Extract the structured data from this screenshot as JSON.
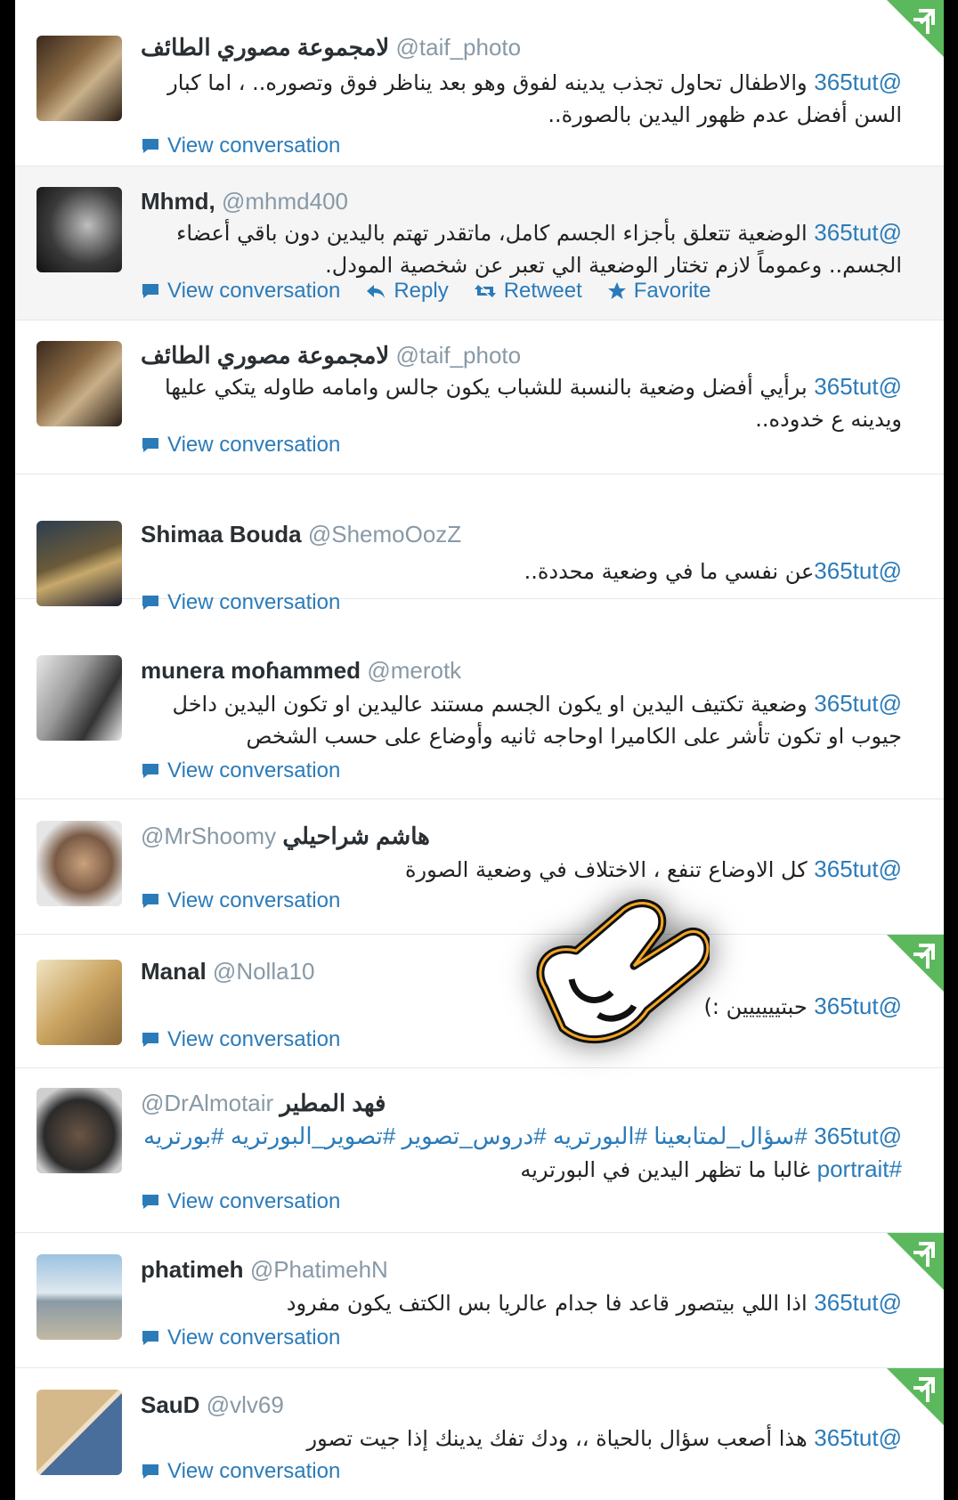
{
  "tweets": [
    {
      "name": "لامجموعة مصوري الطائف",
      "handle": "@taif_photo",
      "mention": "@365tut",
      "text": "والاطفال تحاول تجذب يدينه لفوق وهو بعد يناظر فوق وتصوره.. ، اما كبار السن أفضل عدم ظهور اليدين بالصورة..",
      "view": "View conversation"
    },
    {
      "name": "Mhmd,",
      "handle": "@mhmd400",
      "mention": "@365tut",
      "text": "الوضعية تتعلق بأجزاء الجسم كامل، ماتقدر تهتم باليدين دون باقي أعضاء الجسم.. وعموماً لازم تختار الوضعية الي تعبر عن شخصية المودل.",
      "view": "View conversation",
      "reply": "Reply",
      "retweet": "Retweet",
      "favorite": "Favorite"
    },
    {
      "name": "لامجموعة مصوري الطائف",
      "handle": "@taif_photo",
      "mention": "@365tut",
      "text": "برأيي أفضل وضعية بالنسبة للشباب يكون جالس وامامه طاوله يتكي عليها ويدينه ع خدوده..",
      "view": "View conversation"
    },
    {
      "name": "Shimaa Bouda",
      "handle": "@ShemoOozZ",
      "mention": "@365tut",
      "text": "عن نفسي ما في وضعية محددة..",
      "view": "View conversation"
    },
    {
      "name": "munera moɦammed",
      "handle": "@merotk",
      "mention": "@365tut",
      "text": "وضعية تكتيف اليدين او يكون الجسم مستند عاليدين او تكون اليدين داخل جيوب او تكون تأشر على الكاميرا اوحاجه ثانيه وأوضاع على حسب الشخص",
      "view": "View conversation"
    },
    {
      "name": "هاشم شراحيلي",
      "handle": "@MrShoomy",
      "mention": "@365tut",
      "text": "كل الاوضاع تنفع ، الاختلاف في وضعية الصورة",
      "view": "View conversation"
    },
    {
      "name": "Manal",
      "handle": "@Nolla10",
      "mention": "@365tut",
      "text": "حبتيييييين :)",
      "view": "View conversation"
    },
    {
      "name": "فهد المطير",
      "handle": "@DrAlmotair",
      "mention": "@365tut",
      "tags": "#سؤال_لمتابعينا #البورتريه #دروس_تصوير #تصوير_البورتريه #بورتريه",
      "tag2": "#portrait",
      "text": "غالبا ما تظهر اليدين في البورتريه",
      "view": "View conversation"
    },
    {
      "name": "phatimeh",
      "handle": "@PhatimehN",
      "mention": "@365tut",
      "text": "اذا اللي بيتصور قاعد فا جدام عالريا بس الكتف يكون مفرود",
      "view": "View conversation"
    },
    {
      "name": "SauD",
      "handle": "@vlv69",
      "mention": "@365tut",
      "text": "هذا أصعب سؤال بالحياة ،، ودك تفك يدينك إذا جيت تصور",
      "view": "View conversation"
    }
  ],
  "colors": {
    "link": "#2b7bb9",
    "corner": "#5cb85c"
  }
}
